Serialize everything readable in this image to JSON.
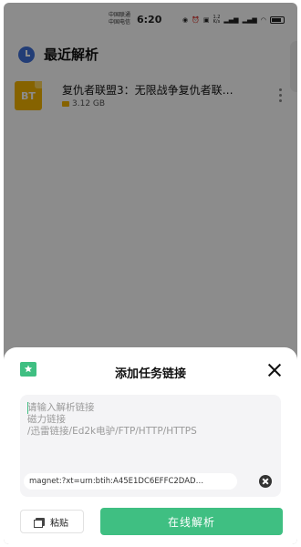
{
  "status_bar": {
    "carrier_1": "中国联通",
    "carrier_2": "中国电信",
    "time": "6:20",
    "net_speed_value": "1.2",
    "net_speed_unit": "K/s"
  },
  "header": {
    "title": "最近解析"
  },
  "recent_items": [
    {
      "title": "复仇者联盟3：无限战争复仇者联…",
      "size": "3.12 GB",
      "badge": "BT"
    }
  ],
  "sheet": {
    "title": "添加任务链接",
    "placeholder_lines": [
      "请输入解析链接",
      "磁力链接",
      "/迅雷链接/Ed2k电驴/FTP/HTTP/HTTPS"
    ],
    "magnet_suggestion": "magnet:?xt=urn:btih:A45E1DC6EFFC2DAD…",
    "paste_label": "粘贴",
    "parse_label": "在线解析"
  },
  "colors": {
    "accent": "#3fbf82",
    "bt_badge": "#f4b400",
    "clock_icon": "#3f6fd8"
  }
}
